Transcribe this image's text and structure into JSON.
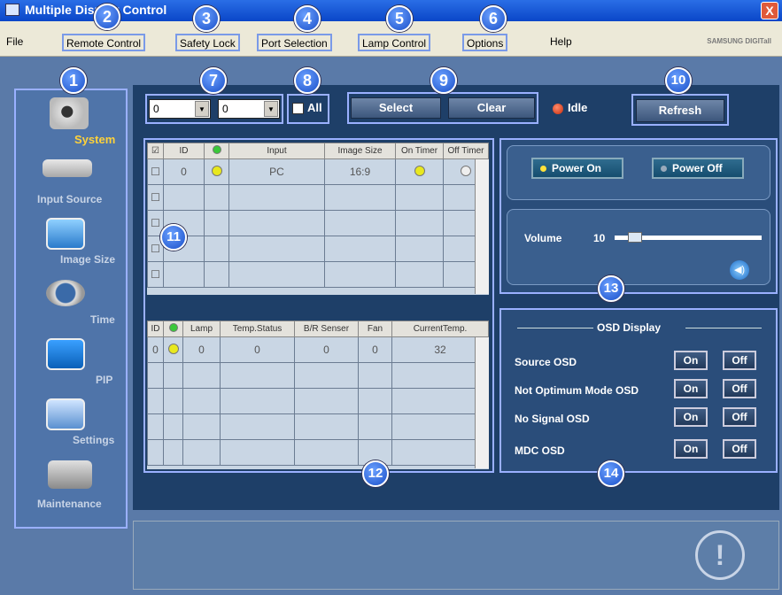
{
  "window": {
    "title": "Multiple Display Control",
    "close": "X"
  },
  "menu": {
    "file": "File",
    "remote_control": "Remote Control",
    "safety_lock": "Safety Lock",
    "port_selection": "Port Selection",
    "lamp_control": "Lamp Control",
    "options": "Options",
    "help": "Help",
    "brand": "SAMSUNG DIGITall"
  },
  "badges": [
    "1",
    "2",
    "3",
    "4",
    "5",
    "6",
    "7",
    "8",
    "9",
    "10",
    "11",
    "12",
    "13",
    "14"
  ],
  "sidebar": {
    "items": [
      {
        "label": "System",
        "icon": "system-icon",
        "selected": true
      },
      {
        "label": "Input Source",
        "icon": "input-source-icon"
      },
      {
        "label": "Image Size",
        "icon": "image-size-icon"
      },
      {
        "label": "Time",
        "icon": "clock-icon"
      },
      {
        "label": "PIP",
        "icon": "pip-icon"
      },
      {
        "label": "Settings",
        "icon": "settings-icon"
      },
      {
        "label": "Maintenance",
        "icon": "maintenance-icon"
      }
    ]
  },
  "toolbar": {
    "combo1": "0",
    "combo2": "0",
    "all_label": "All",
    "select": "Select",
    "clear": "Clear",
    "status": "Idle",
    "refresh": "Refresh"
  },
  "grid1": {
    "headers": [
      "ID",
      "Input",
      "Image Size",
      "On Timer",
      "Off Timer"
    ],
    "row": {
      "id": "0",
      "input": "PC",
      "image_size": "16:9"
    }
  },
  "grid2": {
    "headers": [
      "ID",
      "Lamp",
      "Temp.Status",
      "B/R Senser",
      "Fan",
      "CurrentTemp."
    ],
    "row": {
      "id": "0",
      "lamp": "0",
      "temp_status": "0",
      "br_senser": "0",
      "fan": "0",
      "current_temp": "32"
    }
  },
  "power": {
    "on": "Power On",
    "off": "Power Off",
    "volume_label": "Volume",
    "volume_value": "10",
    "volume_level": 0.1
  },
  "osd": {
    "title": "OSD Display",
    "rows": [
      {
        "label": "Source OSD",
        "on": "On",
        "off": "Off"
      },
      {
        "label": "Not Optimum Mode OSD",
        "on": "On",
        "off": "Off"
      },
      {
        "label": "No Signal OSD",
        "on": "On",
        "off": "Off"
      },
      {
        "label": "MDC OSD",
        "on": "On",
        "off": "Off"
      }
    ]
  },
  "colors": {
    "accent": "#9ab0ff",
    "panel": "#1e3f68",
    "badge": "#1a4fc8"
  }
}
